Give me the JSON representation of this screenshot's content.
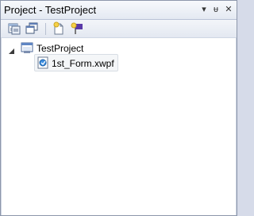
{
  "panel": {
    "title": "Project - TestProject",
    "controls": {
      "menu_glyph": "▾",
      "pin_glyph": "ᵾ",
      "close_glyph": "✕"
    }
  },
  "toolbar": {
    "icons": [
      "properties-icon",
      "window-cascade-icon",
      "new-item-icon",
      "add-item-icon"
    ]
  },
  "tree": {
    "root": {
      "label": "TestProject",
      "icon": "project-icon",
      "expanded": true
    },
    "children": [
      {
        "label": "1st_Form.xwpf",
        "icon": "form-file-icon",
        "selected": true
      }
    ]
  }
}
